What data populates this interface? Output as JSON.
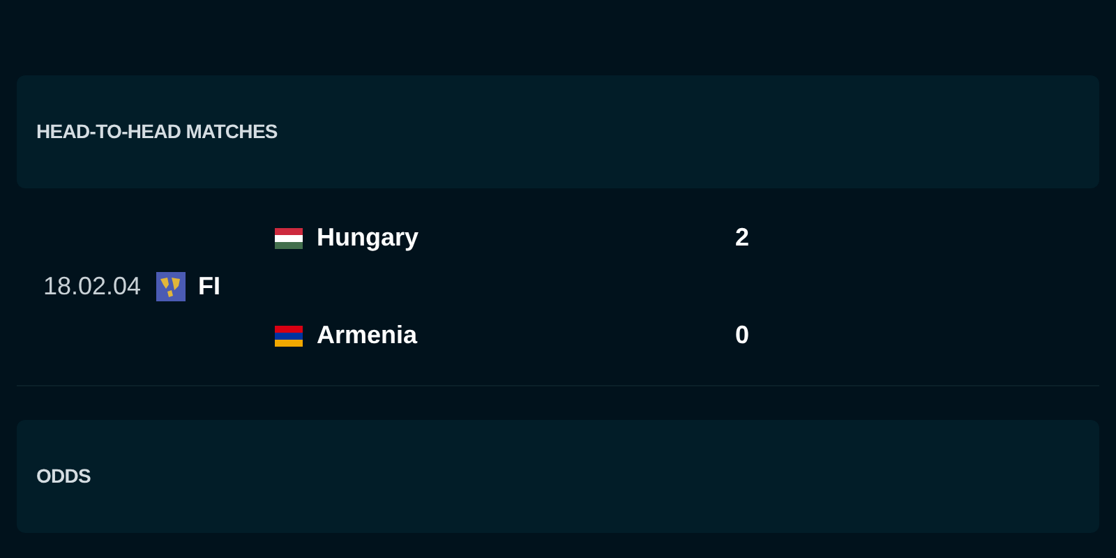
{
  "sections": [
    {
      "title": "HEAD-TO-HEAD MATCHES"
    },
    {
      "title": "ODDS"
    }
  ],
  "matches": [
    {
      "date": "18.02.04",
      "competition": "FI",
      "teams": [
        {
          "name": "Hungary",
          "score": "2"
        },
        {
          "name": "Armenia",
          "score": "0"
        }
      ]
    }
  ]
}
